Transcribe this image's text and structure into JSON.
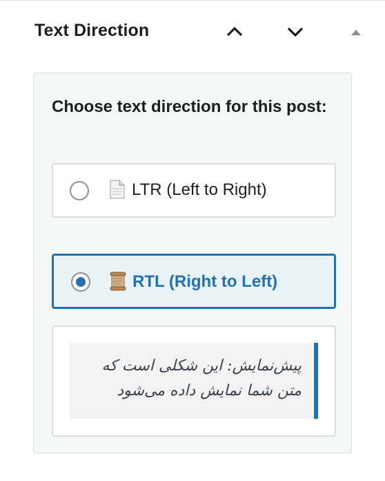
{
  "panel": {
    "title": "Text Direction",
    "move_up_icon": "chevron-up-icon",
    "move_down_icon": "chevron-down-icon",
    "toggle_icon": "caret-up-icon"
  },
  "direction_setting": {
    "question": "Choose text direction for this post:",
    "options": [
      {
        "label": "LTR (Left to Right)",
        "icon": "page-facing-up-icon",
        "selected": false
      },
      {
        "label": "RTL (Right to Left)",
        "icon": "scroll-icon",
        "selected": true
      }
    ]
  },
  "preview": {
    "text": "پیش‌نمایش: این شکلی است که متن شما نمایش داده می‌شود"
  },
  "colors": {
    "accent": "#2271b1",
    "selected_bg": "#e9f2f6",
    "panel_bg": "#f6f7f7",
    "border": "#dcdcde"
  }
}
